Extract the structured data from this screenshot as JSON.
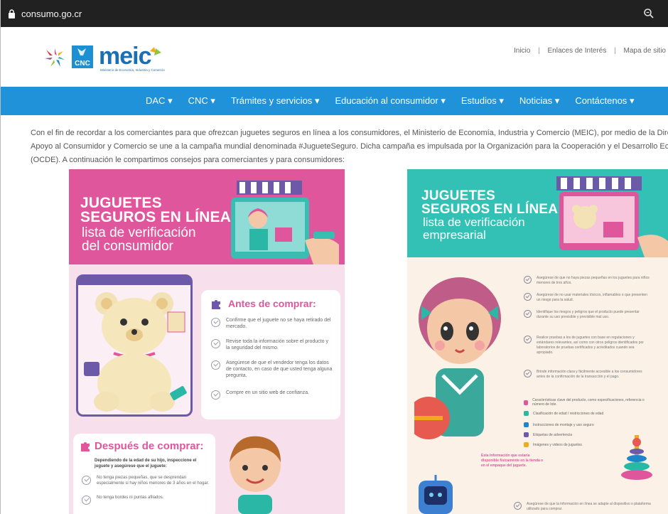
{
  "browser": {
    "url": "consumo.go.cr"
  },
  "header": {
    "logo_cnc": "CNC",
    "logo_meic": "meic",
    "logo_meic_sub": "Ministerio de Economía, Industria y Comercio",
    "links": [
      "Inicio",
      "Enlaces de Interés",
      "Mapa de sitio"
    ]
  },
  "nav": {
    "items": [
      "DAC",
      "CNC",
      "Trámites y servicios",
      "Educación al consumidor",
      "Estudios",
      "Noticias",
      "Contáctenos"
    ]
  },
  "intro": {
    "line1": "Con el fin de recordar a los comerciantes para que ofrezcan juguetes seguros en línea a los consumidores, el Ministerio de Economía, Industria y Comercio (MEIC), por medio de la Dirección de",
    "line2": "Apoyo al Consumidor y Comercio se une a la campaña mundial denominada #JugueteSeguro. Dicha campaña es impulsada por la Organización para la Cooperación y el Desarrollo Económico",
    "line3": "(OCDE). A continuación le compartimos consejos para comerciantes y para consumidores:"
  },
  "consumer_card": {
    "title1": "JUGUETES",
    "title2": "SEGUROS EN LÍNEA:",
    "sub1": "lista de verificación",
    "sub2": "del consumidor",
    "antes_heading": "Antes de comprar:",
    "antes_items": [
      "Confirme que el juguete no se haya retirado del mercado.",
      "Revise toda la información sobre el producto y la seguridad del mismo.",
      "Asegúrese de que el vendedor tenga los datos de contacto, en caso de que usted tenga alguna pregunta.",
      "Compre en un sitio web de confianza."
    ],
    "despues_heading": "Después de comprar:",
    "despues_intro": "Dependiendo de la edad de su hijo, inspeccione el juguete y asegúrese que el juguete:",
    "despues_items": [
      "No tenga piezas pequeñas, que se desprendan especialmente si hay niños menores de 3 años en el hogar.",
      "No tenga bordes ni puntas afilados."
    ]
  },
  "business_card": {
    "title1": "JUGUETES",
    "title2": "SEGUROS EN LÍNEA:",
    "sub1": "lista de verificación",
    "sub2": "empresarial",
    "items": [
      "Asegúrese de que no haya piezas pequeñas en los juguetes para niños menores de tres años.",
      "Asegúrese de no usar materiales tóxicos, inflamables o que presenten un riesgo para la salud.",
      "Identifique los riesgos y peligros que el producto puede presentar durante su uso previsible y previsible mal uso.",
      "Realice pruebas a los de juguetes con base en regulaciones y estándares relevantes, así como con otros peligros identificados por laboratorios de pruebas certificados y acreditados cuando sea apropiado.",
      "Brinde información clara y fácilmente accesible a los consumidores antes de la confirmación de la transacción y el pago."
    ],
    "features": [
      "Características clave del producto, como especificaciones, referencia o número de lote.",
      "Clasificación de edad / restricciones de edad",
      "Instrucciones de montaje y uso seguro",
      "Etiquetas de advertencia",
      "Imágenes y videos de juguetes"
    ],
    "note": "Esta información que estaría disponible físicamente en la tienda o en el empaque del juguete.",
    "bottom_item": "Asegúrese de que la información en línea se adapte al dispositivo o plataforma utilizado para comprar."
  },
  "colors": {
    "nav": "#1f92d9",
    "consumer_pink": "#e0569c",
    "business_teal": "#33c1b6"
  }
}
